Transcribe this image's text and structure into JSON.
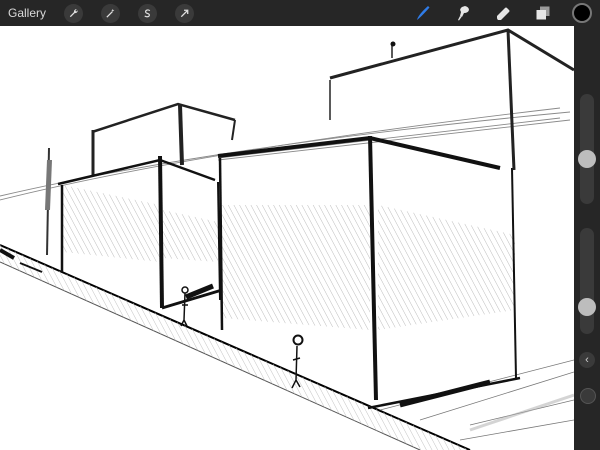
{
  "toolbar": {
    "gallery_label": "Gallery",
    "left_tools": [
      "wrench-icon",
      "magic-wand-icon",
      "selection-s-icon",
      "transform-arrow-icon"
    ],
    "right_tools": [
      "brush-icon",
      "smudge-icon",
      "eraser-icon",
      "layers-icon"
    ],
    "active_tool": "brush-icon",
    "accent_color": "#2f7ce8",
    "current_color": "#000000"
  },
  "sidebar": {
    "controls": [
      "brush-size-slider",
      "chevron-left-icon",
      "brush-opacity-slider",
      "modify-button"
    ]
  }
}
